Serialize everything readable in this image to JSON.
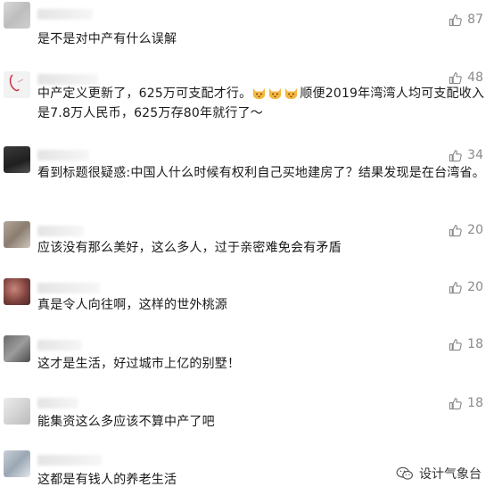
{
  "comments": [
    {
      "text": "是不是对中产有什么误解",
      "likes": "87"
    },
    {
      "text_before": "中产定义更新了，625万可支配才行。",
      "text_after": "顺便2019年湾湾人均可支配收入是7.8万人民币，625万存80年就行了～",
      "emoji": [
        "cat-emoji",
        "cat-emoji",
        "cat-emoji"
      ],
      "likes": "48"
    },
    {
      "text": "看到标题很疑惑:中国人什么时候有权利自己买地建房了？结果发现是在台湾省。",
      "likes": "34"
    },
    {
      "text": "应该没有那么美好，这么多人，过于亲密难免会有矛盾",
      "likes": "20"
    },
    {
      "text": "真是令人向往啊，这样的世外桃源",
      "likes": "20"
    },
    {
      "text": "这才是生活，好过城市上亿的别墅！",
      "likes": "18"
    },
    {
      "text": "能集资这么多应该不算中产了吧",
      "likes": "18"
    },
    {
      "text": "这都是有钱人的养老生活",
      "likes": ""
    }
  ],
  "watermark": {
    "label": "设计气象台",
    "icon": "wechat-icon"
  },
  "icons": {
    "like": "thumbs-up-icon"
  },
  "colors": {
    "text": "#1a1a1a",
    "muted": "#8a8a8a",
    "blur": "#e4e4e4"
  }
}
